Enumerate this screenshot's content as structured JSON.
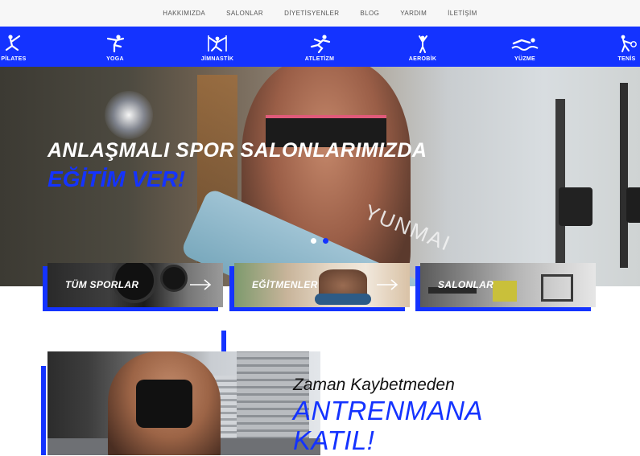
{
  "topnav": {
    "items": [
      "HAKKIMIZDA",
      "SALONLAR",
      "DİYETİSYENLER",
      "BLOG",
      "YARDIM",
      "İLETİŞİM"
    ]
  },
  "sports": {
    "items": [
      {
        "label": "PİLATES",
        "icon": "pilates-icon"
      },
      {
        "label": "YOGA",
        "icon": "yoga-icon"
      },
      {
        "label": "JİMNASTİK",
        "icon": "gymnastics-icon"
      },
      {
        "label": "ATLETİZM",
        "icon": "athletics-icon"
      },
      {
        "label": "AEROBİK",
        "icon": "aerobics-icon"
      },
      {
        "label": "YÜZME",
        "icon": "swimming-icon"
      },
      {
        "label": "TENİS",
        "icon": "tennis-icon"
      }
    ]
  },
  "hero": {
    "line1": "ANLAŞMALI SPOR SALONLARIMIZDA",
    "line2": "EĞİTİM VER!",
    "mat_brand": "YUNMAI",
    "slides": 2,
    "active_slide": 2
  },
  "cards": [
    {
      "label": "TÜM SPORLAR",
      "arrow": true
    },
    {
      "label": "EĞİTMENLER",
      "arrow": true
    },
    {
      "label": "SALONLAR",
      "arrow": false
    }
  ],
  "cta": {
    "line1": "Zaman Kaybetmeden",
    "line2": "ANTRENMANA",
    "line3": "KATIL!"
  },
  "colors": {
    "accent": "#1433ff",
    "topnav_bg": "#f7f7f7",
    "text_dark": "#111111"
  }
}
